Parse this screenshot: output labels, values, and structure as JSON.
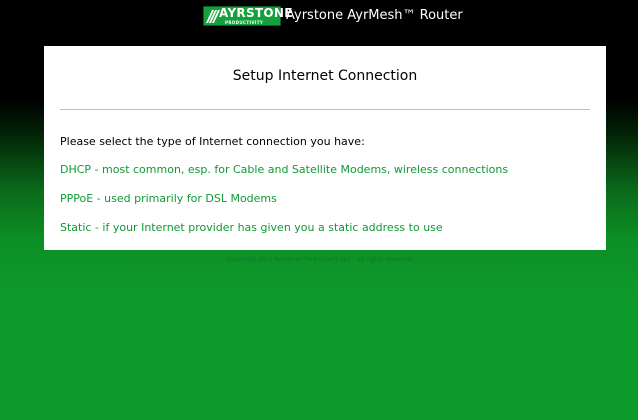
{
  "header": {
    "logo": {
      "name": "AYRSTONE",
      "tagline": "PRODUCTIVITY"
    },
    "title": "Ayrstone AyrMesh™ Router"
  },
  "panel": {
    "title": "Setup Internet Connection",
    "prompt": "Please select the type of Internet connection you have:",
    "options": [
      {
        "label": "DHCP - most common, esp. for Cable and Satellite Modems, wireless connections"
      },
      {
        "label": "PPPoE - used primarily for DSL Modems"
      },
      {
        "label": "Static - if your Internet provider has given you a static address to use"
      }
    ]
  },
  "footer": {
    "copyright": "Copyright 2011 Ayrstone Productivity LLC - all rights reserved"
  },
  "colors": {
    "link": "#0f9a34",
    "logo_bg": "#14a03a",
    "background_top": "#000000",
    "background_bottom": "#0e9a2b"
  }
}
